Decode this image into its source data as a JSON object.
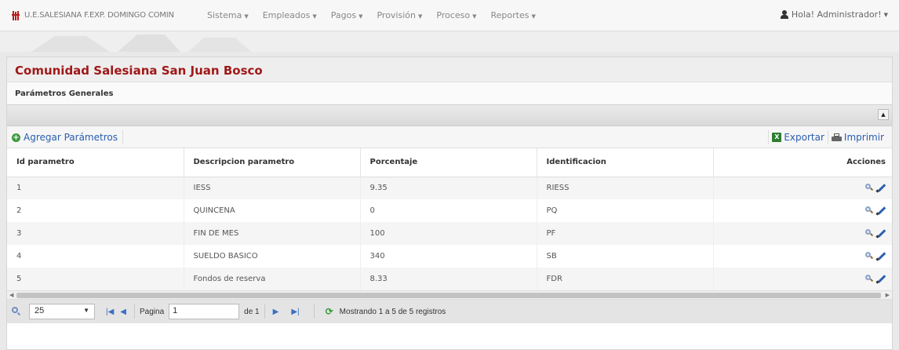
{
  "navbar": {
    "brand": "U.E.SALESIANA F.EXP. DOMINGO COMIN",
    "menu": [
      {
        "label": "Sistema"
      },
      {
        "label": "Empleados"
      },
      {
        "label": "Pagos"
      },
      {
        "label": "Provisión"
      },
      {
        "label": "Proceso"
      },
      {
        "label": "Reportes"
      }
    ],
    "user": "Hola! Administrador!"
  },
  "panel": {
    "title": "Comunidad Salesiana San Juan Bosco",
    "subtitle": "Parámetros Generales"
  },
  "toolbar": {
    "add_label": "Agregar Parámetros",
    "export_label": "Exportar",
    "print_label": "Imprimir"
  },
  "table": {
    "headers": [
      "Id parametro",
      "Descripcion parametro",
      "Porcentaje",
      "Identificacion",
      "Acciones"
    ],
    "rows": [
      {
        "id": "1",
        "descripcion": "IESS",
        "porcentaje": "9.35",
        "identificacion": "RIESS"
      },
      {
        "id": "2",
        "descripcion": "QUINCENA",
        "porcentaje": "0",
        "identificacion": "PQ"
      },
      {
        "id": "3",
        "descripcion": "FIN DE MES",
        "porcentaje": "100",
        "identificacion": "PF"
      },
      {
        "id": "4",
        "descripcion": "SUELDO BASICO",
        "porcentaje": "340",
        "identificacion": "SB"
      },
      {
        "id": "5",
        "descripcion": "Fondos de reserva",
        "porcentaje": "8.33",
        "identificacion": "FDR"
      }
    ]
  },
  "pager": {
    "page_size": "25",
    "page_label": "Pagina",
    "page_value": "1",
    "of_label": "de 1",
    "status": "Mostrando 1 a 5 de 5 registros"
  },
  "colors": {
    "title": "#a01818",
    "link": "#2a5db0",
    "brand_logo": "#b71c1c"
  }
}
